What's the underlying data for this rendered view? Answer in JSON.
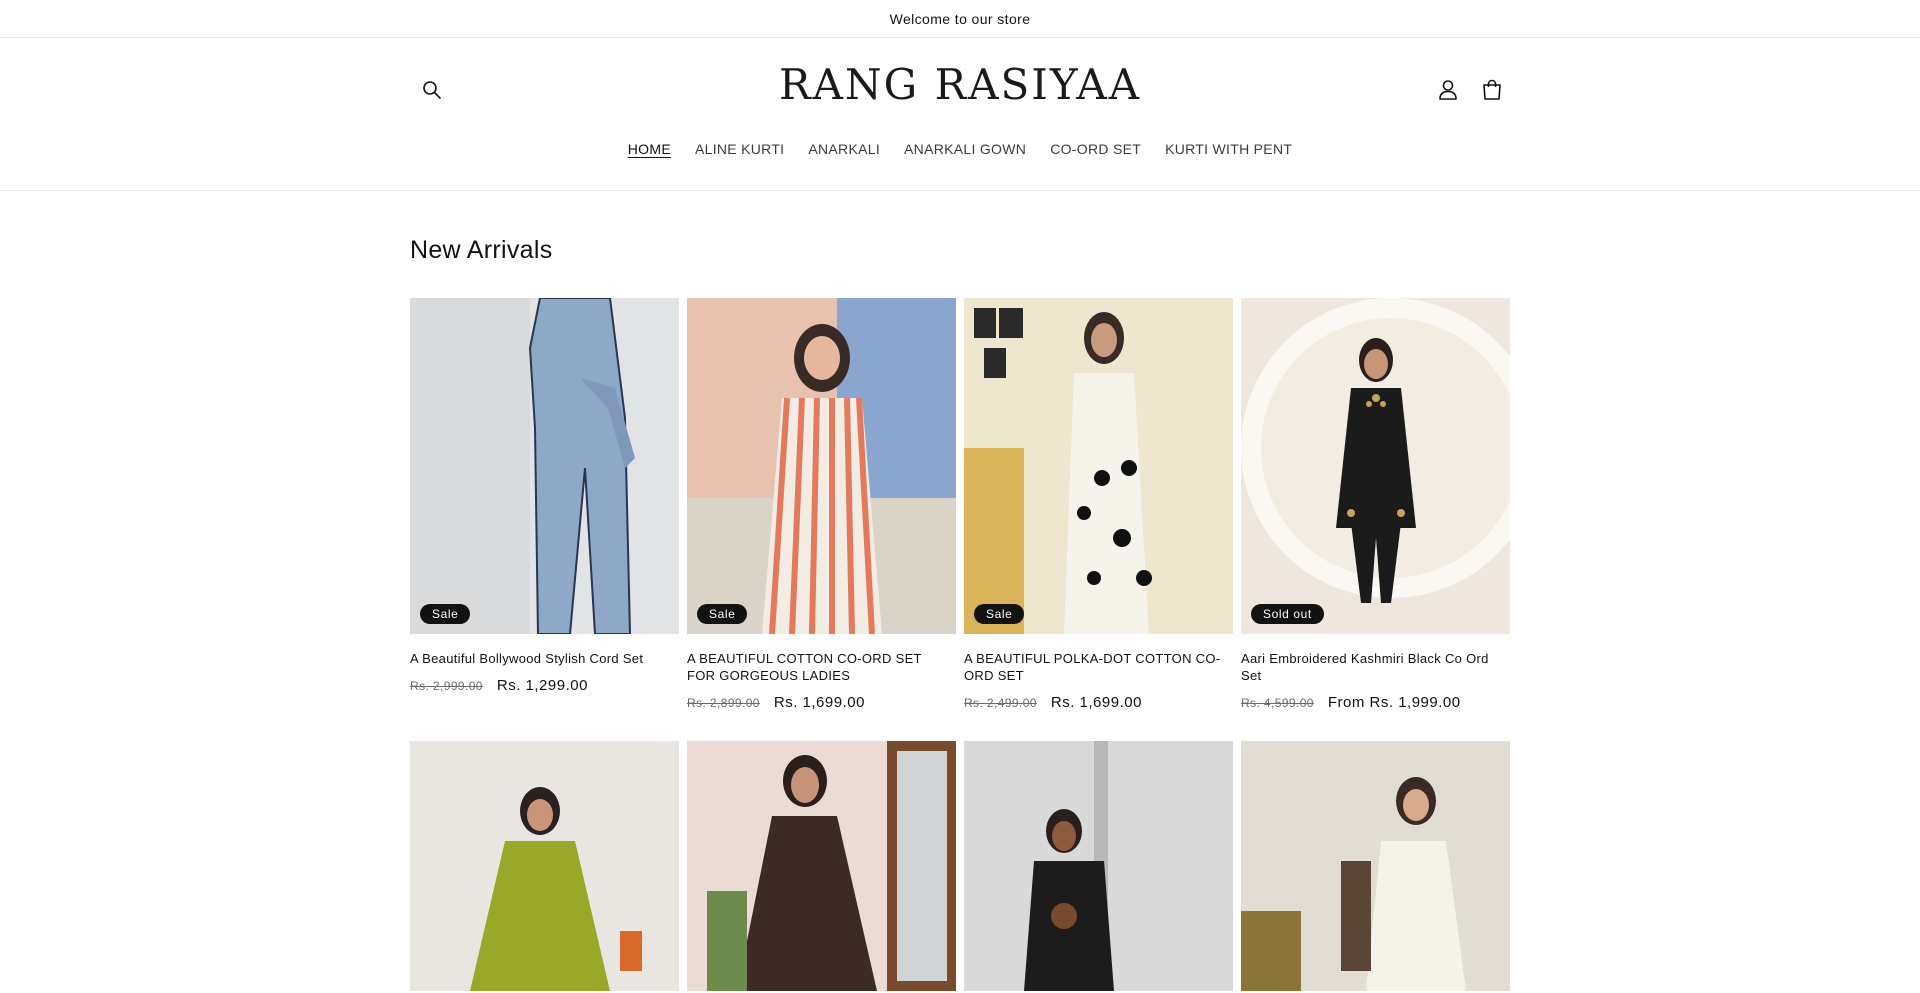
{
  "announcement": "Welcome to our store",
  "header": {
    "logo": "RANG RASIYAA",
    "icons": {
      "search": "search-icon",
      "account": "user-icon",
      "cart": "cart-icon"
    }
  },
  "nav": [
    "HOME",
    "ALINE KURTI",
    "ANARKALI",
    "ANARKALI GOWN",
    "CO-ORD SET",
    "KURTI WITH PENT"
  ],
  "section_title": "New Arrivals",
  "products": [
    {
      "title": "A Beautiful Bollywood Stylish Cord Set",
      "badge": "Sale",
      "old_price": "Rs. 2,999.00",
      "price": "Rs. 1,299.00"
    },
    {
      "title": "A BEAUTIFUL COTTON CO-ORD SET FOR GORGEOUS LADIES",
      "badge": "Sale",
      "old_price": "Rs. 2,899.00",
      "price": "Rs. 1,699.00"
    },
    {
      "title": "A BEAUTIFUL POLKA-DOT COTTON CO-ORD SET",
      "badge": "Sale",
      "old_price": "Rs. 2,499.00",
      "price": "Rs. 1,699.00"
    },
    {
      "title": "Aari Embroidered Kashmiri Black Co Ord Set",
      "badge": "Sold out",
      "old_price": "Rs. 4,599.00",
      "price": "From Rs. 1,999.00"
    }
  ],
  "colors": {
    "text": "#121212",
    "badge_bg": "#121212",
    "border": "#e5e5e5"
  }
}
